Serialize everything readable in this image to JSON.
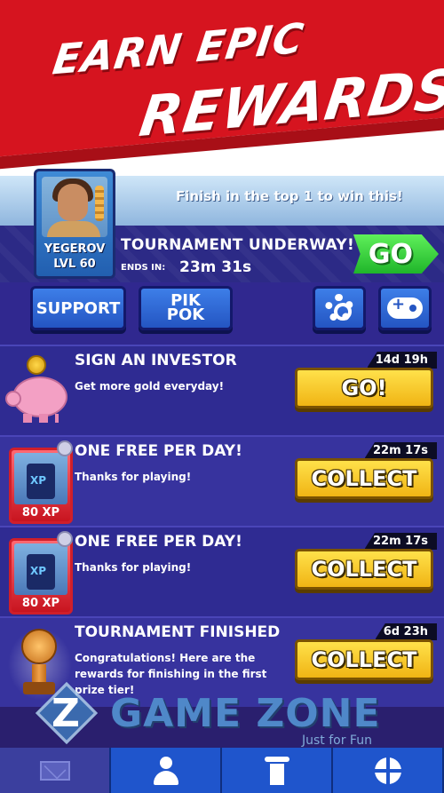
{
  "banner": {
    "line1": "EARN EPIC",
    "line2": "REWARDS!"
  },
  "tournament": {
    "win_text": "Finish in the top 1 to win this!",
    "player_name": "YEGEROV",
    "player_level": "LVL 60",
    "title": "TOURNAMENT UNDERWAY!",
    "ends_label": "ENDS IN:",
    "ends_value": "23m 31s",
    "go_label": "GO"
  },
  "buttons": {
    "support": "SUPPORT",
    "pikpok_line1": "PIK",
    "pikpok_line2": "POK",
    "settings_icon": "gear-icon",
    "gamepad_icon": "gamepad-icon"
  },
  "rewards": [
    {
      "title": "SIGN AN INVESTOR",
      "desc": "Get more gold everyday!",
      "timer": "14d 19h",
      "button": "GO!",
      "icon": "piggy-bank-icon"
    },
    {
      "title": "ONE FREE PER DAY!",
      "desc": "Thanks for playing!",
      "timer": "22m 17s",
      "button": "COLLECT",
      "icon": "xp-card-icon",
      "badge": "80 XP"
    },
    {
      "title": "ONE FREE PER DAY!",
      "desc": "Thanks for playing!",
      "timer": "22m 17s",
      "button": "COLLECT",
      "icon": "xp-card-icon",
      "badge": "80 XP"
    },
    {
      "title": "TOURNAMENT FINISHED",
      "desc": "Congratulations! Here are the rewards for finishing in the first prize tier!",
      "timer": "6d 23h",
      "button": "COLLECT",
      "icon": "trophy-icon"
    }
  ],
  "watermark": {
    "logo_letter": "Z",
    "brand": "GAME ZONE",
    "tagline": "Just for Fun"
  },
  "nav": {
    "tabs": [
      "inbox",
      "profile",
      "leaderboard",
      "play"
    ]
  },
  "colors": {
    "banner_red": "#d6141f",
    "go_green": "#1fb52a",
    "collect_yellow": "#f0b414",
    "panel_purple": "#2f2b92"
  }
}
